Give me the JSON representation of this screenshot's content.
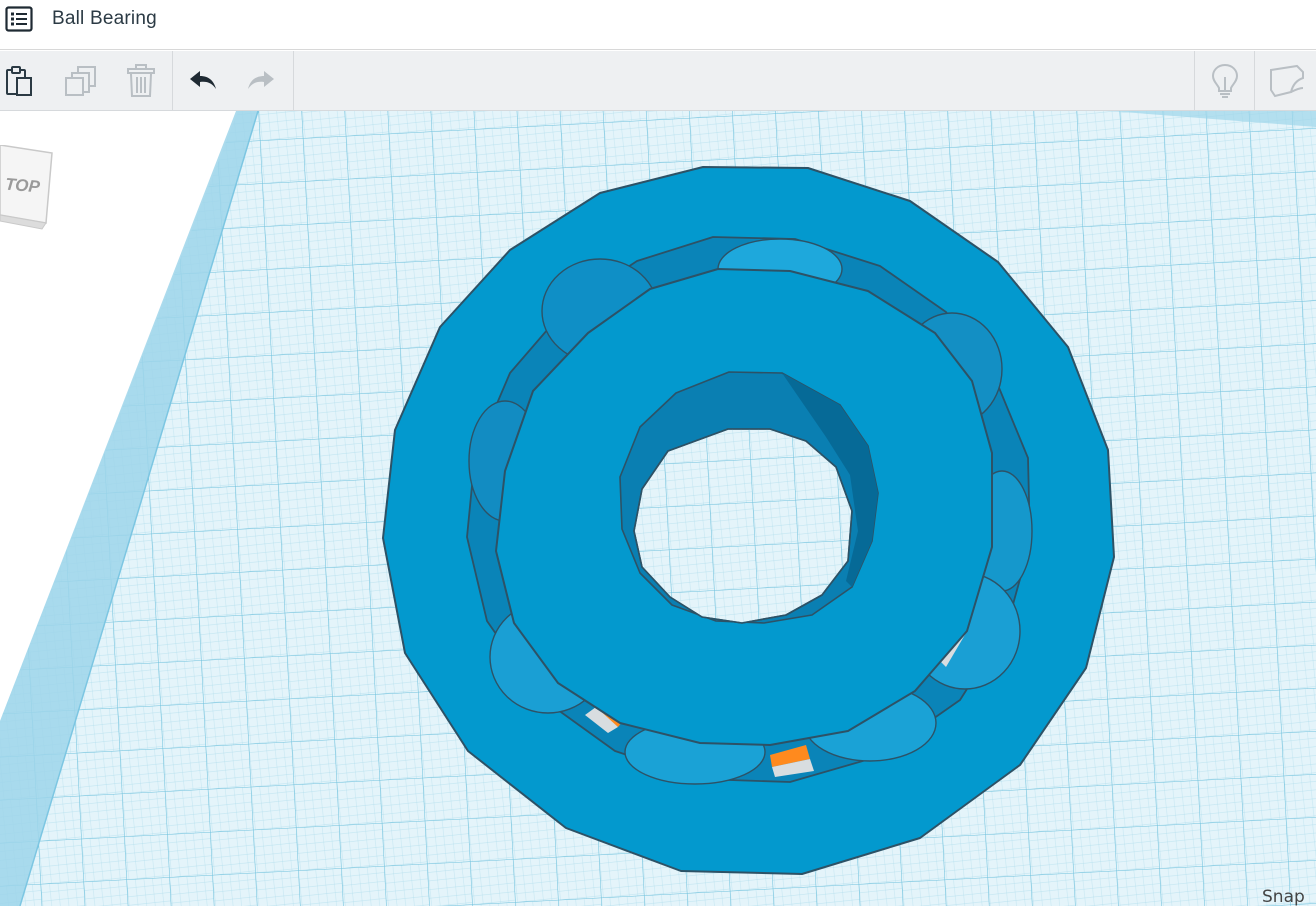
{
  "document": {
    "title": "Ball Bearing"
  },
  "header": {
    "menu_icon": "list-icon"
  },
  "toolbar": {
    "paste_icon": "paste-icon",
    "duplicate_icon": "duplicate-icon",
    "delete_icon": "trash-icon",
    "undo_icon": "undo-icon",
    "redo_icon": "redo-icon",
    "notes_icon": "lightbulb-icon",
    "shape_icon": "shape-icon"
  },
  "viewcube": {
    "face_label": "TOP"
  },
  "workplane": {
    "snap_label": "Snap",
    "grid_color": "#6cc0dc",
    "plane_color": "#e4f4fa",
    "shape_color": "#0399ce",
    "accent_color": "#ff8a1e"
  }
}
